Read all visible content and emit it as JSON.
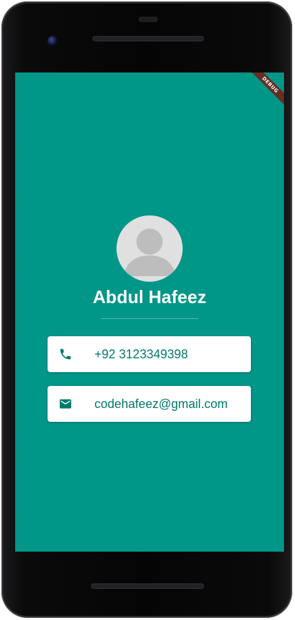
{
  "app": {
    "debug_banner": "DEBUG"
  },
  "profile": {
    "avatar_icon": "person-avatar-icon",
    "name": "Abdul Hafeez"
  },
  "contacts": [
    {
      "icon": "phone-icon",
      "text": "+92 3123349398"
    },
    {
      "icon": "email-icon",
      "text": "codehafeez@gmail.com"
    }
  ],
  "colors": {
    "background": "#009688",
    "card": "#FFFFFF",
    "contact_text": "#00796B",
    "name_text": "#FFFFFF",
    "debug_banner": "#751C14"
  }
}
